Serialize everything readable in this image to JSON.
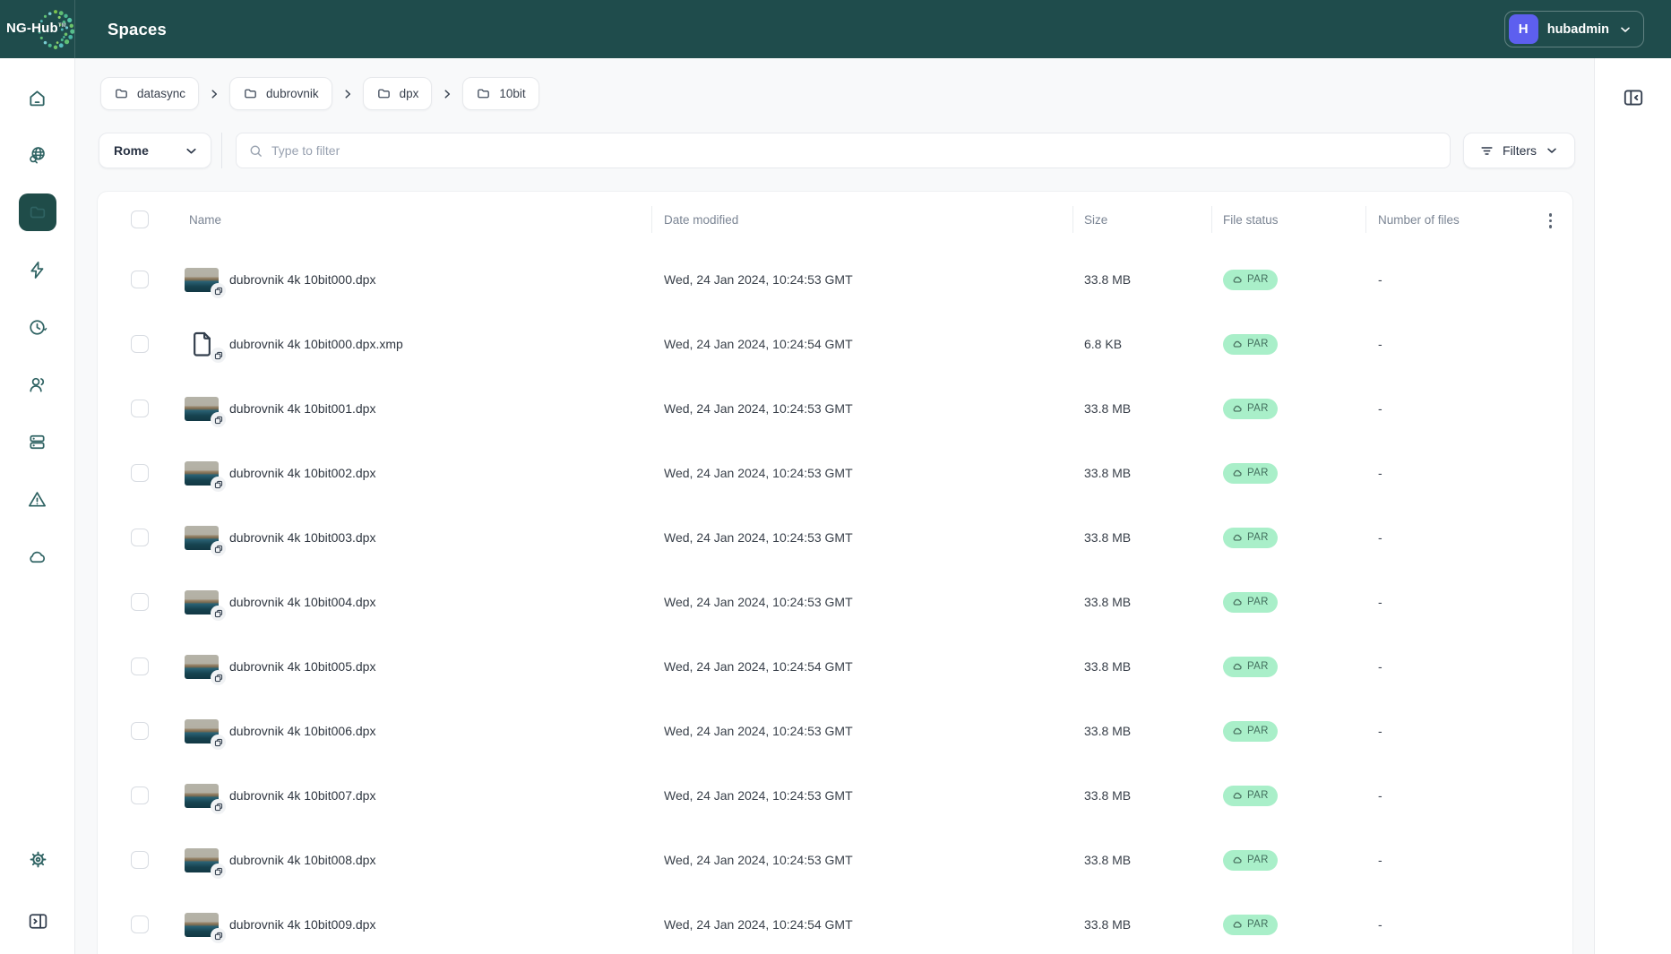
{
  "app": {
    "logo_text": "NG-Hub",
    "title": "Spaces",
    "user": {
      "initial": "H",
      "name": "hubadmin"
    }
  },
  "colors": {
    "header_teal": "#1F4C4C",
    "active_tile_teal": "#1F4C49",
    "accent_green": "#3BCD7D",
    "avatar_indigo": "#5D5FEF",
    "status_badge_bg": "#A9EFC9",
    "status_badge_text": "#44705F"
  },
  "sidebar": {
    "items": [
      "home-icon",
      "discover-globe-search-icon",
      "files-folder-icon",
      "activity-zap-icon",
      "history-clock-icon",
      "users-icon",
      "storage-server-icon",
      "alerts-warning-icon",
      "cloud-icon"
    ],
    "active_item": "files-folder-icon",
    "bottom_items": [
      "settings-gear-icon",
      "expand-panel-icon"
    ]
  },
  "right_rail": {
    "toggle": "collapse-panel-icon"
  },
  "breadcrumbs": [
    "datasync",
    "dubrovnik",
    "dpx",
    "10bit"
  ],
  "filter_bar": {
    "scope_selector": {
      "value": "Rome"
    },
    "search": {
      "placeholder": "Type to filter",
      "value": ""
    },
    "filters_button": {
      "label": "Filters"
    }
  },
  "table": {
    "columns": [
      "Name",
      "Date modified",
      "Size",
      "File status",
      "Number of files"
    ],
    "rows": [
      {
        "name": "dubrovnik 4k 10bit000.dpx",
        "kind": "image",
        "date": "Wed, 24 Jan 2024, 10:24:53 GMT",
        "size": "33.8 MB",
        "status": "PAR",
        "files": "-"
      },
      {
        "name": "dubrovnik 4k 10bit000.dpx.xmp",
        "kind": "document",
        "date": "Wed, 24 Jan 2024, 10:24:54 GMT",
        "size": "6.8 KB",
        "status": "PAR",
        "files": "-"
      },
      {
        "name": "dubrovnik 4k 10bit001.dpx",
        "kind": "image",
        "date": "Wed, 24 Jan 2024, 10:24:53 GMT",
        "size": "33.8 MB",
        "status": "PAR",
        "files": "-"
      },
      {
        "name": "dubrovnik 4k 10bit002.dpx",
        "kind": "image",
        "date": "Wed, 24 Jan 2024, 10:24:53 GMT",
        "size": "33.8 MB",
        "status": "PAR",
        "files": "-"
      },
      {
        "name": "dubrovnik 4k 10bit003.dpx",
        "kind": "image",
        "date": "Wed, 24 Jan 2024, 10:24:53 GMT",
        "size": "33.8 MB",
        "status": "PAR",
        "files": "-"
      },
      {
        "name": "dubrovnik 4k 10bit004.dpx",
        "kind": "image",
        "date": "Wed, 24 Jan 2024, 10:24:53 GMT",
        "size": "33.8 MB",
        "status": "PAR",
        "files": "-"
      },
      {
        "name": "dubrovnik 4k 10bit005.dpx",
        "kind": "image",
        "date": "Wed, 24 Jan 2024, 10:24:54 GMT",
        "size": "33.8 MB",
        "status": "PAR",
        "files": "-"
      },
      {
        "name": "dubrovnik 4k 10bit006.dpx",
        "kind": "image",
        "date": "Wed, 24 Jan 2024, 10:24:53 GMT",
        "size": "33.8 MB",
        "status": "PAR",
        "files": "-"
      },
      {
        "name": "dubrovnik 4k 10bit007.dpx",
        "kind": "image",
        "date": "Wed, 24 Jan 2024, 10:24:53 GMT",
        "size": "33.8 MB",
        "status": "PAR",
        "files": "-"
      },
      {
        "name": "dubrovnik 4k 10bit008.dpx",
        "kind": "image",
        "date": "Wed, 24 Jan 2024, 10:24:53 GMT",
        "size": "33.8 MB",
        "status": "PAR",
        "files": "-"
      },
      {
        "name": "dubrovnik 4k 10bit009.dpx",
        "kind": "image",
        "date": "Wed, 24 Jan 2024, 10:24:54 GMT",
        "size": "33.8 MB",
        "status": "PAR",
        "files": "-"
      }
    ]
  }
}
